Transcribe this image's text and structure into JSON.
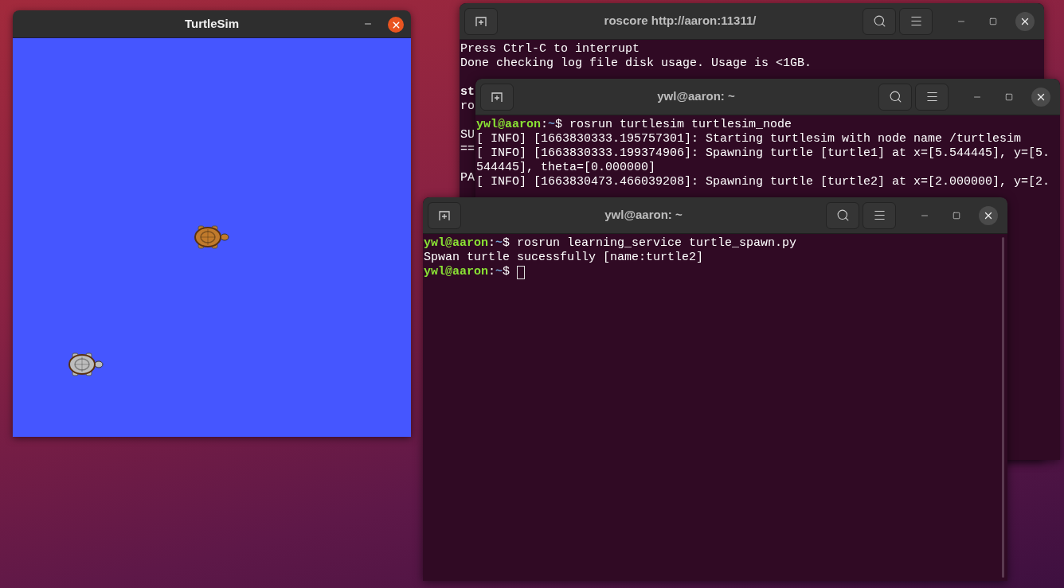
{
  "windows": [
    {
      "kind": "turtlesim",
      "title": "TurtleSim",
      "turtles": [
        {
          "color": "#c07a2c"
        },
        {
          "color": "#bdbdbd"
        }
      ]
    },
    {
      "kind": "terminal",
      "title": "roscore http://aaron:11311/",
      "blocks": [
        [
          {
            "kind": "output",
            "text": "Press Ctrl-C to interrupt",
            "bold": false
          },
          {
            "kind": "output",
            "text": "Done checking log file disk usage. Usage is <1GB.",
            "bold": false
          }
        ],
        [
          {
            "kind": "output",
            "text": "st",
            "bold": true
          },
          {
            "kind": "output",
            "text": "ro",
            "bold": false
          }
        ],
        [
          {
            "kind": "output",
            "text": "SU",
            "bold": false
          },
          {
            "kind": "output",
            "text": "==",
            "bold": false
          }
        ],
        [
          {
            "kind": "output",
            "text": "PA",
            "bold": false
          }
        ]
      ]
    },
    {
      "kind": "terminal",
      "title": "ywl@aaron: ~",
      "blocks": [
        [
          {
            "kind": "prompt",
            "user": "ywl@aaron",
            "sep": ":",
            "path": "~",
            "symbol": "$",
            "command": "rosrun turtlesim turtlesim_node",
            "cursor": false
          },
          {
            "kind": "output",
            "text": "[ INFO] [1663830333.195757301]: Starting turtlesim with node name /turtlesim",
            "bold": false
          },
          {
            "kind": "output",
            "text": "[ INFO] [1663830333.199374906]: Spawning turtle [turtle1] at x=[5.544445], y=[5.",
            "bold": false
          },
          {
            "kind": "output",
            "text": "544445], theta=[0.000000]",
            "bold": false
          },
          {
            "kind": "output",
            "text": "[ INFO] [1663830473.466039208]: Spawning turtle [turtle2] at x=[2.000000], y=[2.",
            "bold": false
          }
        ]
      ]
    },
    {
      "kind": "terminal",
      "title": "ywl@aaron: ~",
      "blocks": [
        [
          {
            "kind": "prompt",
            "user": "ywl@aaron",
            "sep": ":",
            "path": "~",
            "symbol": "$",
            "command": "rosrun learning_service turtle_spawn.py",
            "cursor": false
          },
          {
            "kind": "output",
            "text": "Spwan turtle sucessfully [name:turtle2]",
            "bold": false
          },
          {
            "kind": "prompt",
            "user": "ywl@aaron",
            "sep": ":",
            "path": "~",
            "symbol": "$",
            "cursor": true
          }
        ]
      ]
    }
  ]
}
